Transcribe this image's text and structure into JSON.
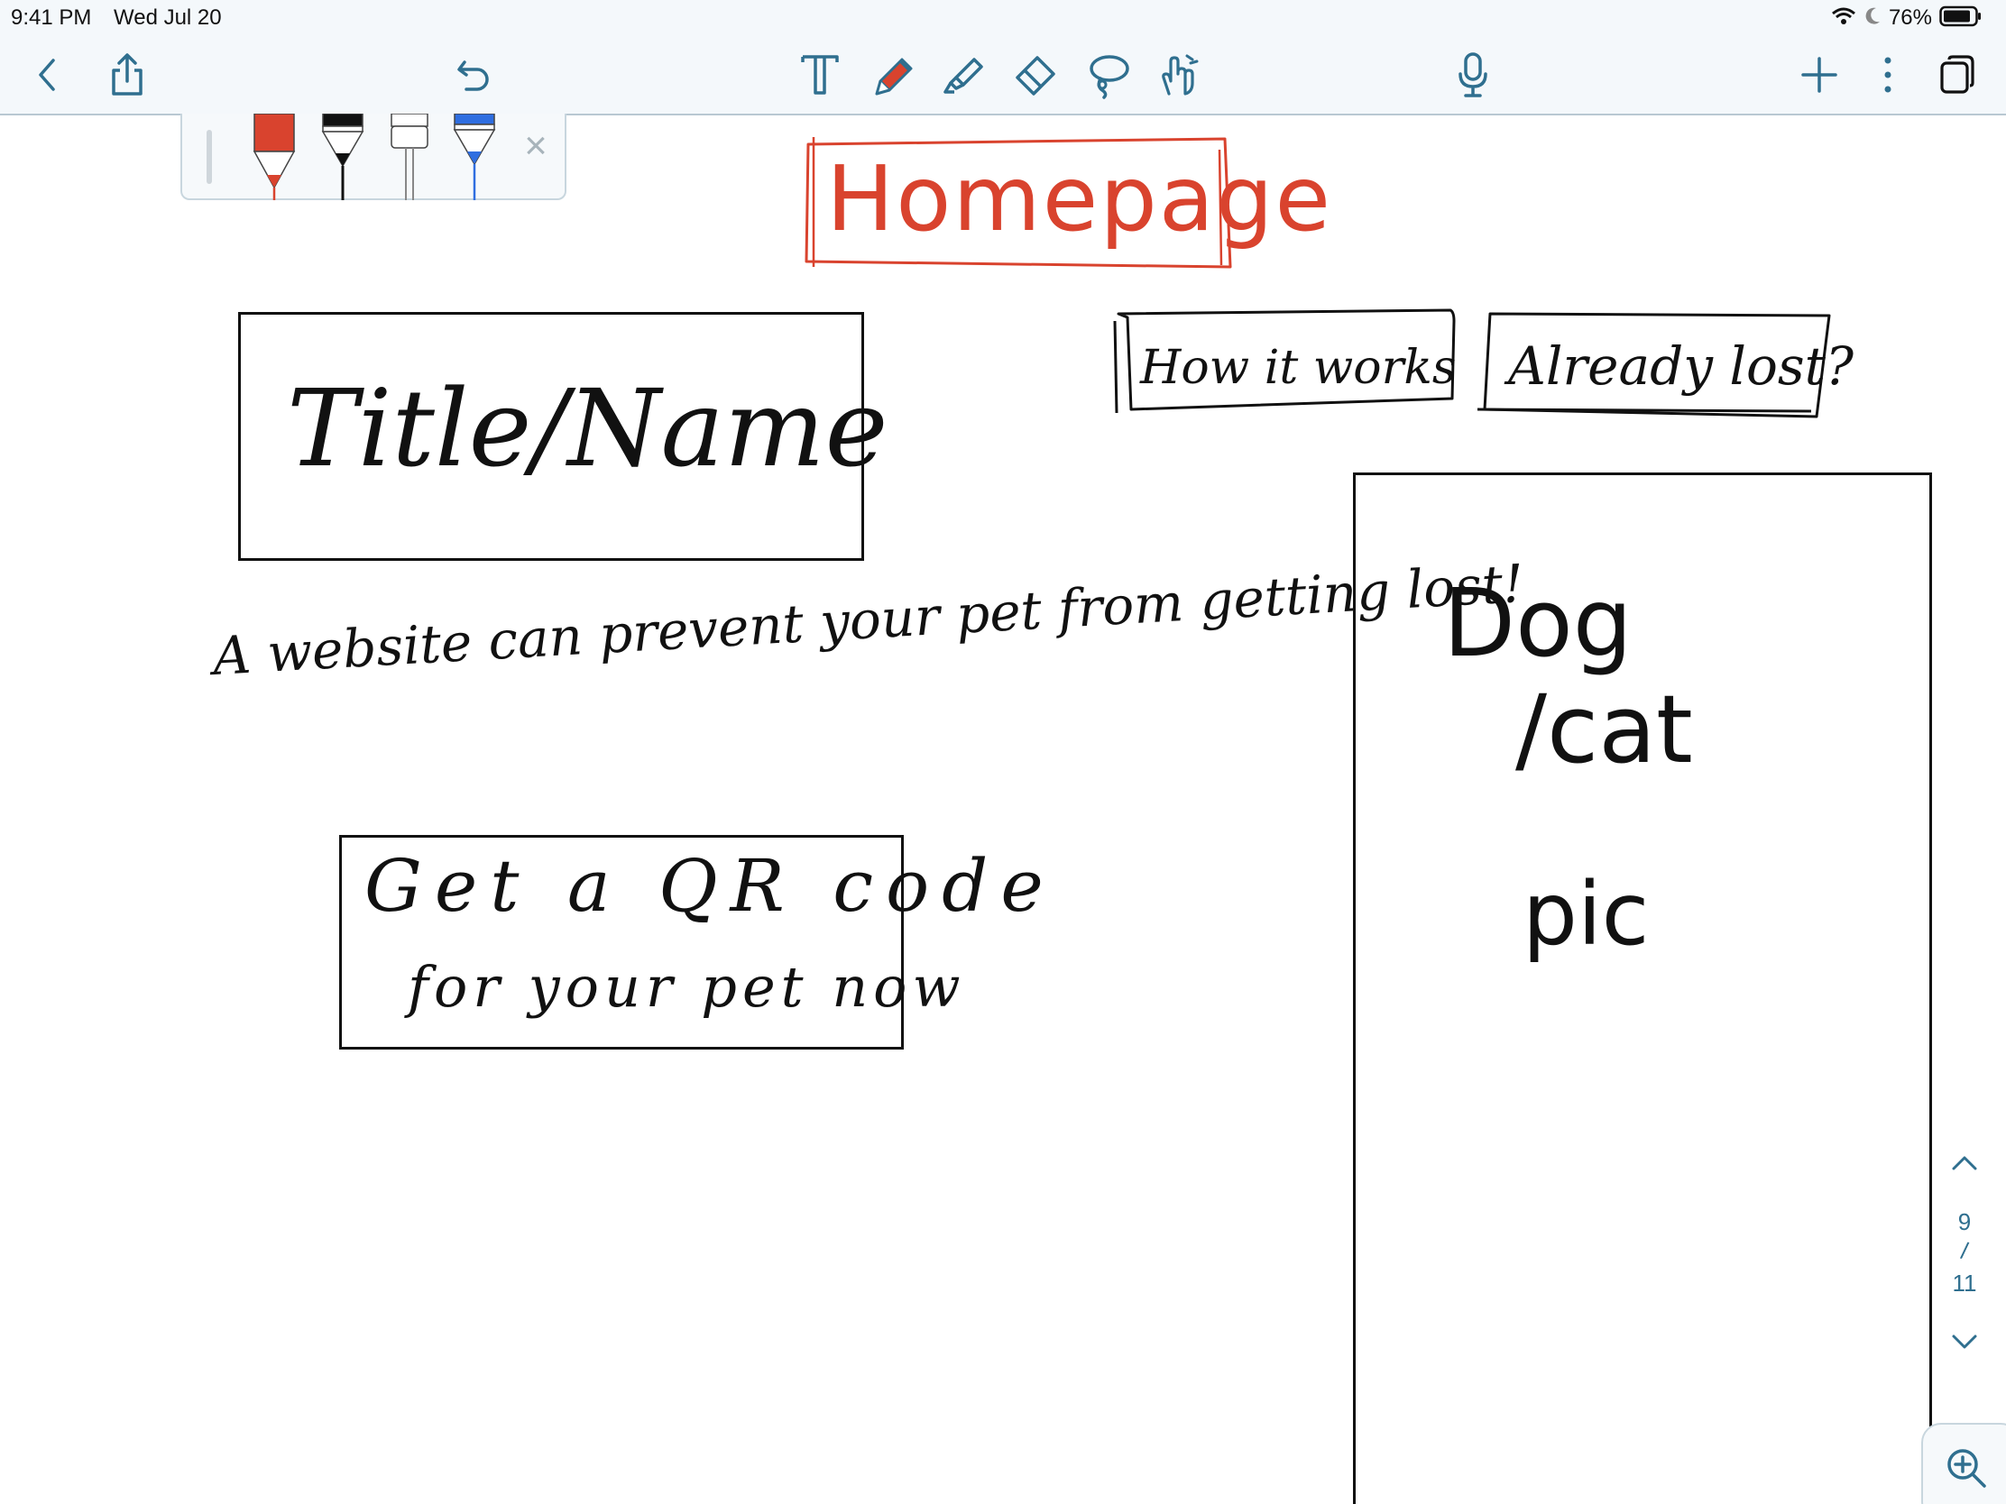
{
  "status_bar": {
    "time": "9:41 PM",
    "date": "Wed Jul 20",
    "battery": "76%"
  },
  "toolbar": {
    "icons": [
      "back-icon",
      "share-icon",
      "undo-icon",
      "text-tool-icon",
      "pen-tool-icon",
      "highlighter-tool-icon",
      "eraser-tool-icon",
      "lasso-tool-icon",
      "hand-pointer-icon",
      "microphone-icon",
      "add-icon",
      "more-icon",
      "pages-icon"
    ],
    "accent": "#2f6f8f"
  },
  "pen_palette": {
    "pens": [
      {
        "color": "#d9432e"
      },
      {
        "color": "#111111"
      },
      {
        "color": "#ffffff"
      },
      {
        "color": "#2f6ee0"
      }
    ],
    "close_glyph": "×"
  },
  "sketch": {
    "heading": "Homepage",
    "heading_color": "#d9432e",
    "title_box": "Title/Name",
    "nav_links": [
      "How it works",
      "Already lost?"
    ],
    "tagline": "A website can prevent your pet from getting lost!",
    "cta_line1": "Get a QR code",
    "cta_line2": "for your pet now",
    "image_line1": "Dog",
    "image_line2": "/cat",
    "image_line3": "pic"
  },
  "page_navigator": {
    "current": "9",
    "separator": "/",
    "total": "11"
  }
}
